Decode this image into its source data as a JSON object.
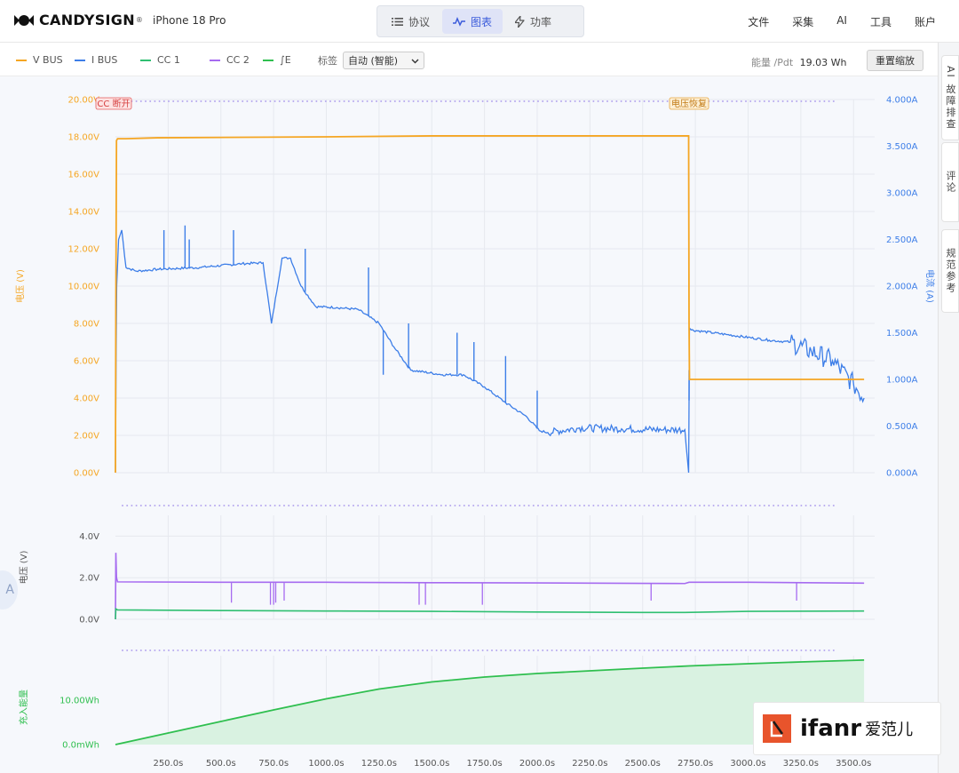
{
  "brand": {
    "name": "CANDYSIGN",
    "mark": "®"
  },
  "device": {
    "name": "iPhone 18 Pro"
  },
  "view_tabs": [
    {
      "label": "协议",
      "icon": "list-icon",
      "active": false
    },
    {
      "label": "图表",
      "icon": "chart-line-icon",
      "active": true
    },
    {
      "label": "功率",
      "icon": "bolt-icon",
      "active": false
    }
  ],
  "top_menu": [
    "文件",
    "采集",
    "AI",
    "工具",
    "账户"
  ],
  "legend": {
    "items": [
      {
        "label": "V BUS",
        "color": "#f5a623"
      },
      {
        "label": "I BUS",
        "color": "#3d7ee8"
      },
      {
        "label": "CC 1",
        "color": "#2fbf71"
      },
      {
        "label": "CC 2",
        "color": "#a66bf0"
      },
      {
        "label": "∫E",
        "color": "#2fbf4f"
      }
    ],
    "label_select_label": "标签",
    "label_select_value": "自动 (智能)",
    "energy_label": "能量 /Pdt",
    "energy_value": "19.03 Wh",
    "reset_zoom_label": "重置缩放"
  },
  "side_tabs": [
    "AI 故障排查",
    "评论",
    "规范参考"
  ],
  "watermark": {
    "text": "ifanr",
    "cn": "爱范儿"
  },
  "chart_data": [
    {
      "type": "line",
      "ylabel": "电压 (V)",
      "y2label": "电流 (A)",
      "ylim": [
        0,
        20
      ],
      "y2lim": [
        0,
        4
      ],
      "xlim": [
        0,
        3600
      ],
      "yticks": [
        "0.00V",
        "2.00V",
        "4.00V",
        "6.00V",
        "8.00V",
        "10.00V",
        "12.00V",
        "14.00V",
        "16.00V",
        "18.00V",
        "20.00V"
      ],
      "y2ticks": [
        "0.000A",
        "0.500A",
        "1.000A",
        "1.500A",
        "2.000A",
        "2.500A",
        "3.000A",
        "3.500A",
        "4.000A"
      ],
      "annotations": [
        {
          "label": "CC 断开",
          "x": 0
        },
        {
          "label": "电压恢复",
          "x": 2720
        }
      ],
      "series": [
        {
          "name": "V BUS",
          "axis": "left",
          "x": [
            0,
            2,
            5,
            10,
            20,
            50,
            200,
            1000,
            1500,
            2000,
            2700,
            2718,
            2720,
            2722,
            3250,
            3550
          ],
          "y": [
            0,
            9,
            17.8,
            17.9,
            17.9,
            17.9,
            17.95,
            18.0,
            18.05,
            18.05,
            18.05,
            18.05,
            8,
            5,
            5,
            5
          ]
        },
        {
          "name": "I BUS",
          "axis": "right",
          "x": [
            0,
            3,
            6,
            15,
            30,
            50,
            100,
            200,
            400,
            600,
            700,
            740,
            790,
            830,
            880,
            950,
            1050,
            1150,
            1250,
            1320,
            1400,
            1550,
            1650,
            1750,
            1850,
            1950,
            2010,
            2050,
            2200,
            2400,
            2600,
            2700,
            2718,
            2722,
            2730,
            2900,
            3100,
            3200,
            3300,
            3400,
            3500,
            3550
          ],
          "y": [
            0,
            1.2,
            2.0,
            2.5,
            2.6,
            2.2,
            2.16,
            2.18,
            2.2,
            2.24,
            2.25,
            1.6,
            2.3,
            2.3,
            2.0,
            1.78,
            1.77,
            1.75,
            1.6,
            1.35,
            1.1,
            1.05,
            1.05,
            0.92,
            0.75,
            0.6,
            0.45,
            0.43,
            0.48,
            0.47,
            0.46,
            0.46,
            0.0,
            1.55,
            1.53,
            1.48,
            1.42,
            1.4,
            1.3,
            1.2,
            0.95,
            0.8
          ]
        }
      ]
    },
    {
      "type": "line",
      "ylabel": "电压 (V)",
      "ylim": [
        0,
        5
      ],
      "xlim": [
        0,
        3600
      ],
      "yticks": [
        "0.0V",
        "2.0V",
        "4.0V"
      ],
      "series": [
        {
          "name": "CC 2",
          "x": [
            0,
            2,
            5,
            10,
            500,
            1000,
            1500,
            2000,
            2500,
            2700,
            2720,
            3000,
            3550
          ],
          "y": [
            0,
            3.2,
            2.0,
            1.8,
            1.78,
            1.78,
            1.76,
            1.75,
            1.73,
            1.72,
            1.78,
            1.78,
            1.74
          ]
        },
        {
          "name": "CC 1",
          "x": [
            0,
            2,
            10,
            500,
            1000,
            1500,
            2000,
            2500,
            2700,
            3000,
            3550
          ],
          "y": [
            0,
            0.5,
            0.45,
            0.42,
            0.4,
            0.38,
            0.35,
            0.33,
            0.33,
            0.38,
            0.4
          ]
        }
      ]
    },
    {
      "type": "area",
      "ylabel": "充入能量",
      "ylim": [
        0,
        20
      ],
      "xlim": [
        0,
        3600
      ],
      "yticks": [
        "0.0mWh",
        "10.00Wh"
      ],
      "xticks": [
        "250.0s",
        "500.0s",
        "750.0s",
        "1000.0s",
        "1250.0s",
        "1500.0s",
        "1750.0s",
        "2000.0s",
        "2250.0s",
        "2500.0s",
        "2750.0s",
        "3000.0s",
        "3250.0s",
        "3500.0s"
      ],
      "series": [
        {
          "name": "∫E",
          "x": [
            0,
            250,
            500,
            750,
            1000,
            1250,
            1500,
            1750,
            2000,
            2250,
            2500,
            2720,
            3000,
            3250,
            3550
          ],
          "y": [
            0,
            2.6,
            5.2,
            7.8,
            10.3,
            12.5,
            14.1,
            15.2,
            16.0,
            16.6,
            17.2,
            17.7,
            18.2,
            18.6,
            19.03
          ]
        }
      ]
    }
  ]
}
